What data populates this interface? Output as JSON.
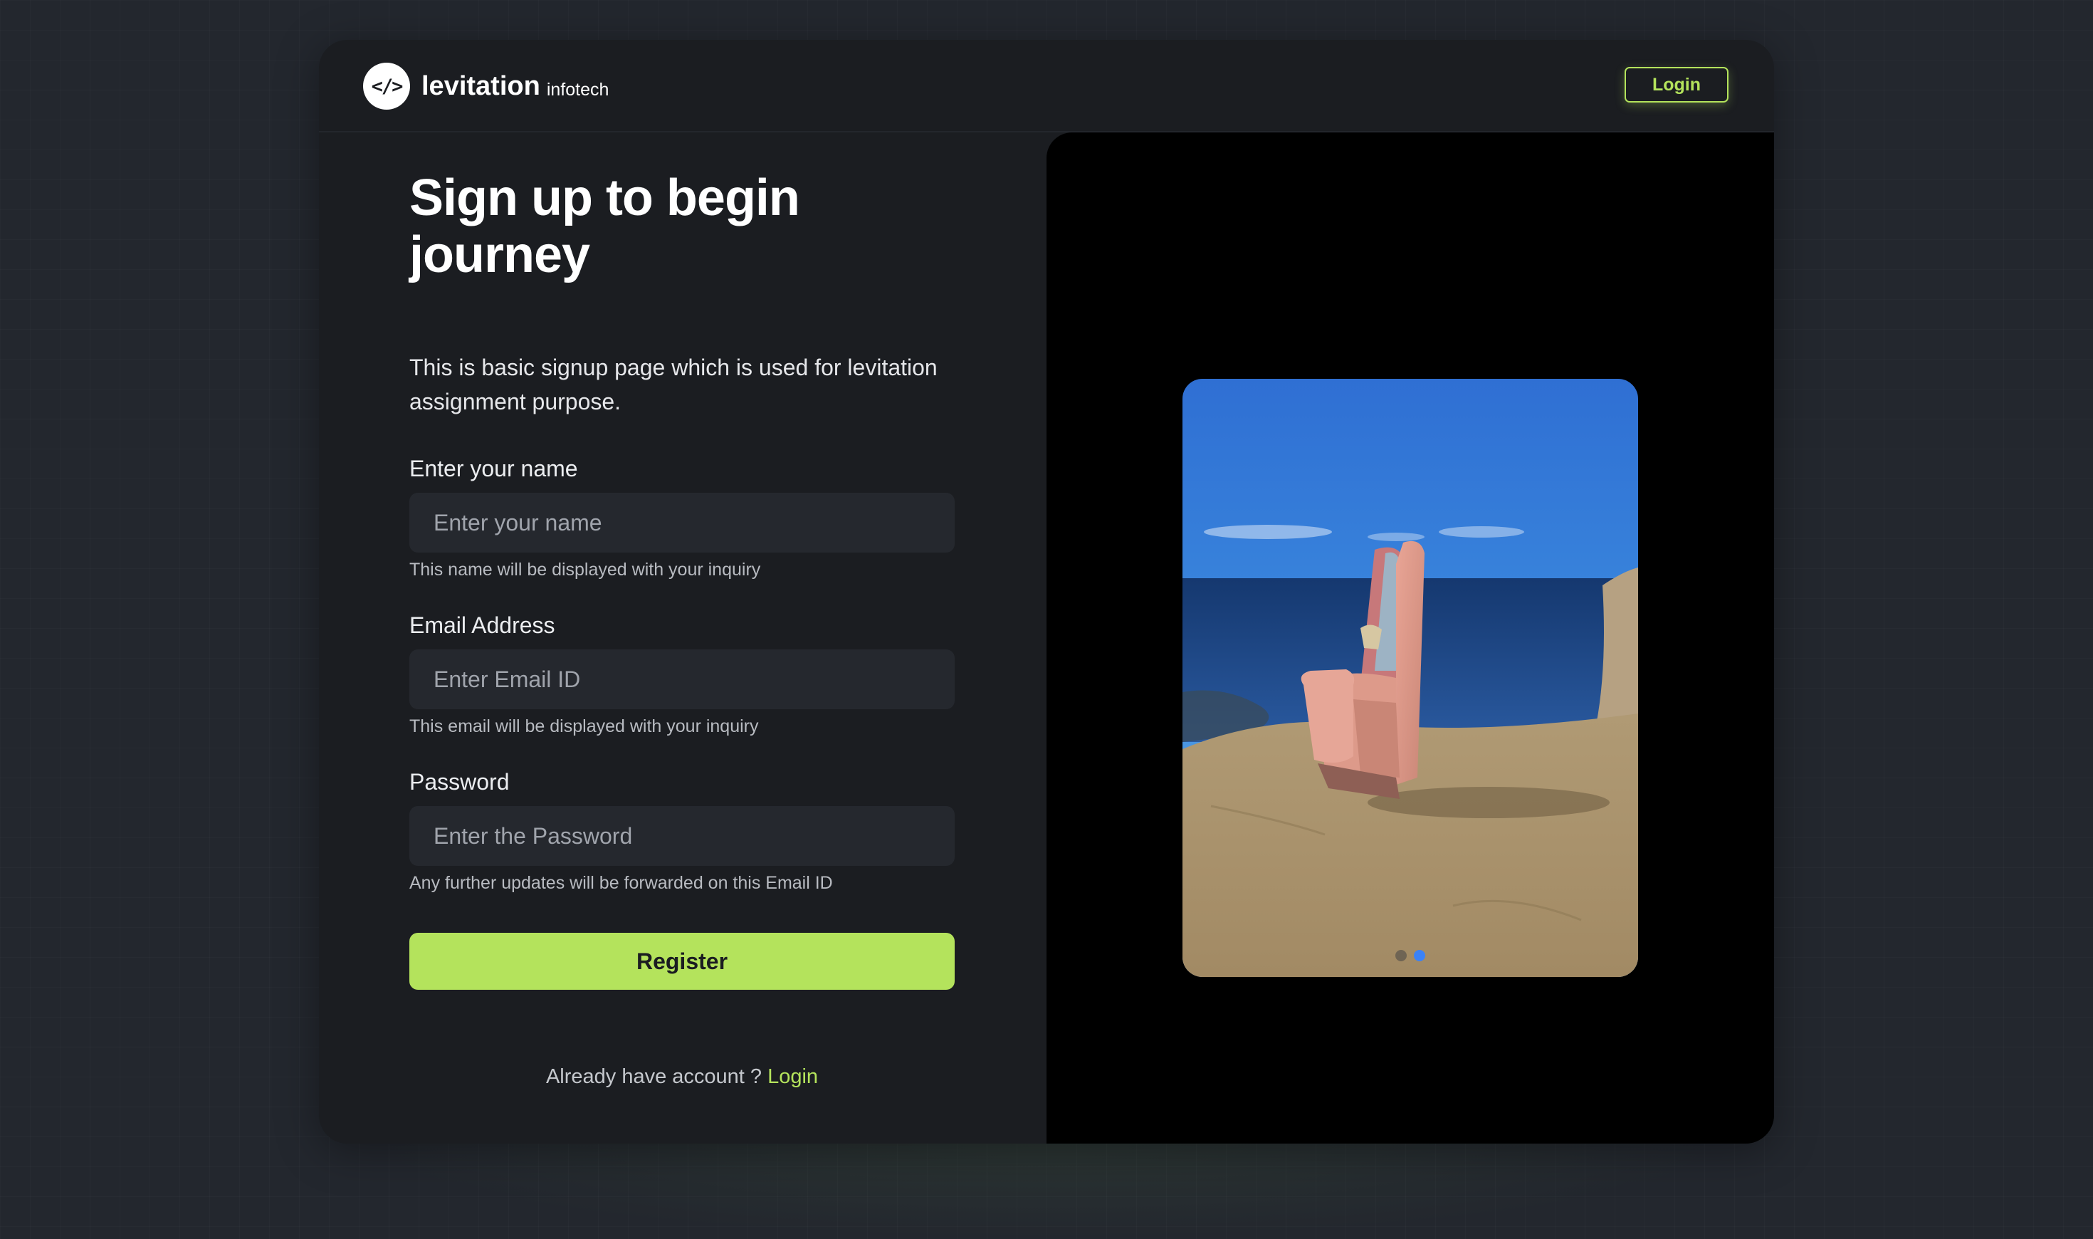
{
  "brand": {
    "logo_glyph": "</>",
    "name": "levitation",
    "sub": "infotech"
  },
  "header": {
    "login_label": "Login"
  },
  "signup": {
    "title": "Sign up to begin journey",
    "subtitle": "This is basic signup page which is used for levitation assignment purpose.",
    "name_label": "Enter your name",
    "name_placeholder": "Enter your name",
    "name_value": "",
    "name_hint": "This name will be displayed with your inquiry",
    "email_label": "Email Address",
    "email_placeholder": "Enter Email ID",
    "email_value": "",
    "email_hint": "This email will be displayed with your inquiry",
    "password_label": "Password",
    "password_placeholder": "Enter the Password",
    "password_value": "",
    "password_hint": "Any further updates will be forwarded on this Email ID",
    "register_label": "Register",
    "already_text": "Already have account ? ",
    "login_link": "Login"
  },
  "carousel": {
    "slide_count": 2,
    "active_index": 1,
    "colors": {
      "active_dot": "#3b82f6",
      "inactive_dot": "#464646"
    }
  },
  "theme": {
    "accent": "#b4e35c",
    "background": "#23272e",
    "card": "#1b1d21",
    "input_bg": "#25282e"
  }
}
